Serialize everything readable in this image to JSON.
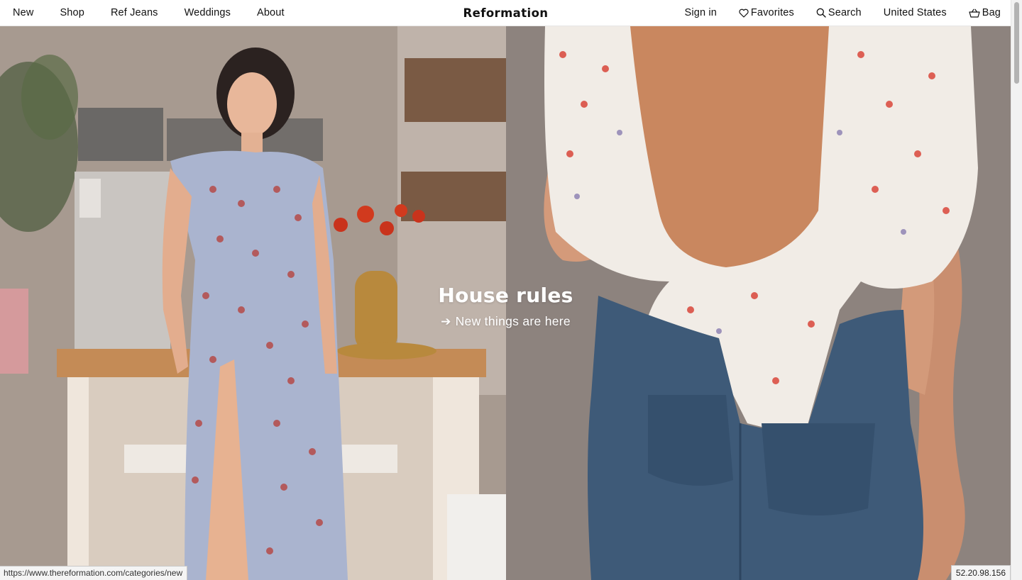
{
  "header": {
    "nav_left": [
      {
        "label": "New"
      },
      {
        "label": "Shop"
      },
      {
        "label": "Ref Jeans"
      },
      {
        "label": "Weddings"
      },
      {
        "label": "About"
      }
    ],
    "brand": "Reformation",
    "nav_right": {
      "sign_in": "Sign in",
      "favorites": {
        "label": "Favorites",
        "icon": "heart-icon"
      },
      "search": {
        "label": "Search",
        "icon": "search-icon"
      },
      "country": "United States",
      "bag": {
        "label": "Bag",
        "icon": "bag-icon"
      }
    }
  },
  "hero": {
    "title": "House rules",
    "cta_arrow": "➔",
    "cta": "New things are here",
    "left_image": "Model in blue floral midi dress with thigh slit leaning on a kitchen counter beside red tulips",
    "right_image": "Back view of open-back floral tie blouse with high-waisted blue jeans"
  },
  "status": {
    "url": "https://www.thereformation.com/categories/new",
    "ip": "52.20.98.156"
  },
  "colors": {
    "background": "#ffffff",
    "text": "#111111",
    "hero_text": "#ffffff"
  }
}
